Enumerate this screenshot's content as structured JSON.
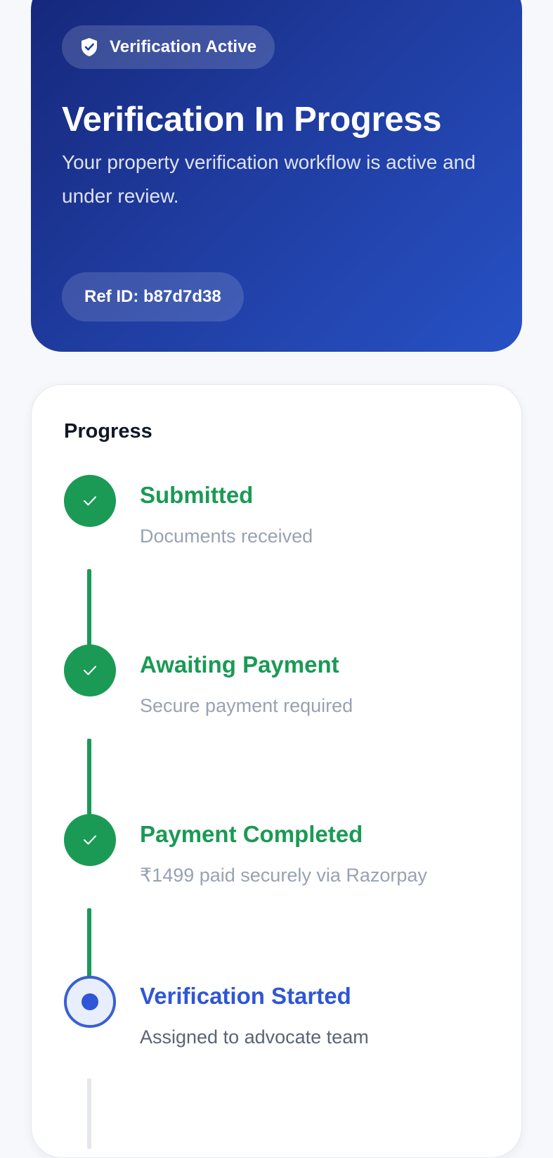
{
  "hero": {
    "status_label": "Verification Active",
    "status_icon": "shield-check-icon",
    "title": "Verification In Progress",
    "subtitle": "Your property verification workflow is active and under review.",
    "ref_label": "Ref ID: b87d7d38"
  },
  "progress": {
    "title": "Progress",
    "steps": [
      {
        "label": "Submitted",
        "desc": "Documents received",
        "state": "done"
      },
      {
        "label": "Awaiting Payment",
        "desc": "Secure payment required",
        "state": "done"
      },
      {
        "label": "Payment Completed",
        "desc": "₹1499 paid securely via Razorpay",
        "state": "done"
      },
      {
        "label": "Verification Started",
        "desc": "Assigned to advocate team",
        "state": "active"
      }
    ]
  },
  "colors": {
    "hero_gradient_start": "#15277a",
    "hero_gradient_end": "#2751c4",
    "done_green": "#1a9a55",
    "active_blue": "#2f56d6",
    "muted_text": "#98a2b3"
  }
}
